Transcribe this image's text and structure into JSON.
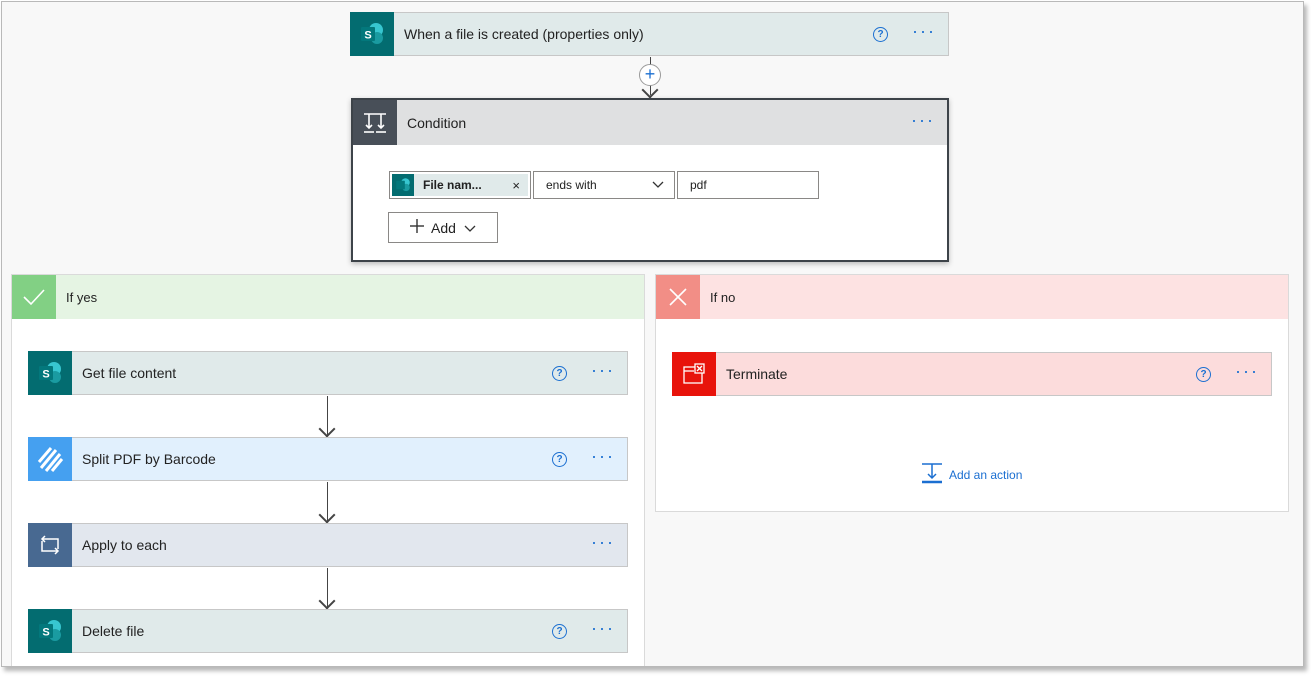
{
  "trigger": {
    "label": "When a file is created (properties only)",
    "icon": "sharepoint-icon"
  },
  "condition": {
    "title": "Condition",
    "token_label": "File nam...",
    "token_remove": "×",
    "operator": "ends with",
    "value": "pdf",
    "add_label": "Add"
  },
  "if_yes": {
    "title": "If yes",
    "actions": [
      {
        "label": "Get file content",
        "icon": "sharepoint-icon"
      },
      {
        "label": "Split PDF by Barcode",
        "icon": "barcode-stripes-icon"
      },
      {
        "label": "Apply to each",
        "icon": "loop-icon"
      },
      {
        "label": "Delete file",
        "icon": "sharepoint-icon"
      }
    ]
  },
  "if_no": {
    "title": "If no",
    "actions": [
      {
        "label": "Terminate",
        "icon": "terminate-icon"
      }
    ],
    "add_action": "Add an action"
  },
  "common": {
    "help": "?",
    "more": "···"
  },
  "colors": {
    "sharepoint": "#036c70",
    "condition_header": "#484f58",
    "yes_header": "#e5f4e3",
    "yes_icon": "#82d084",
    "no_header": "#fde2e2",
    "no_icon": "#f28e86",
    "terminate": "#e8130b",
    "plugin": "#45a0f0",
    "loop": "#486991",
    "accent": "#1b6fd1"
  }
}
